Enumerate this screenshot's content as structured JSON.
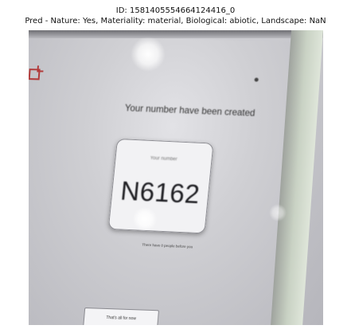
{
  "header": {
    "id_line": "ID: 1581405554664124416_0",
    "pred_line": "Pred - Nature: Yes, Materiality: material, Biological: abiotic, Landscape: NaN"
  },
  "photo": {
    "screen_heading": "Your number have been created",
    "card_label": "Your number",
    "queue_number": "N6162",
    "people_before": "There have 0 people before you",
    "done_button": "That's all for now"
  },
  "colors": {
    "logo_red": "#b23b3b",
    "screen_gray": "#cfcfd3",
    "card_white": "#f2f2f4"
  }
}
